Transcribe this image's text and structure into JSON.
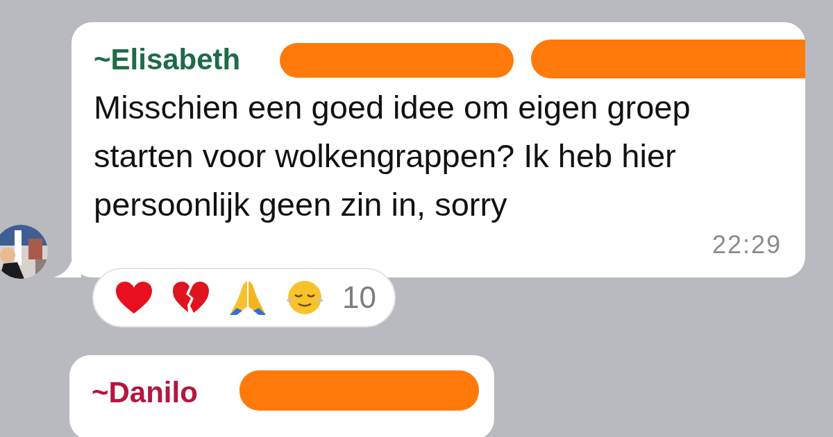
{
  "messages": [
    {
      "sender": "~Elisabeth",
      "color": "#1f6b47",
      "text": "Misschien een goed idee om eigen groep starten voor wolkengrappen? Ik heb hier persoonlijk geen zin in, sorry",
      "time": "22:29",
      "reactions": [
        {
          "kind": "heart"
        },
        {
          "kind": "broken-heart"
        },
        {
          "kind": "praying-hands"
        },
        {
          "kind": "relieved-face"
        }
      ],
      "reaction_count": "10"
    },
    {
      "sender": "~Danilo",
      "color": "#b3173d"
    }
  ]
}
